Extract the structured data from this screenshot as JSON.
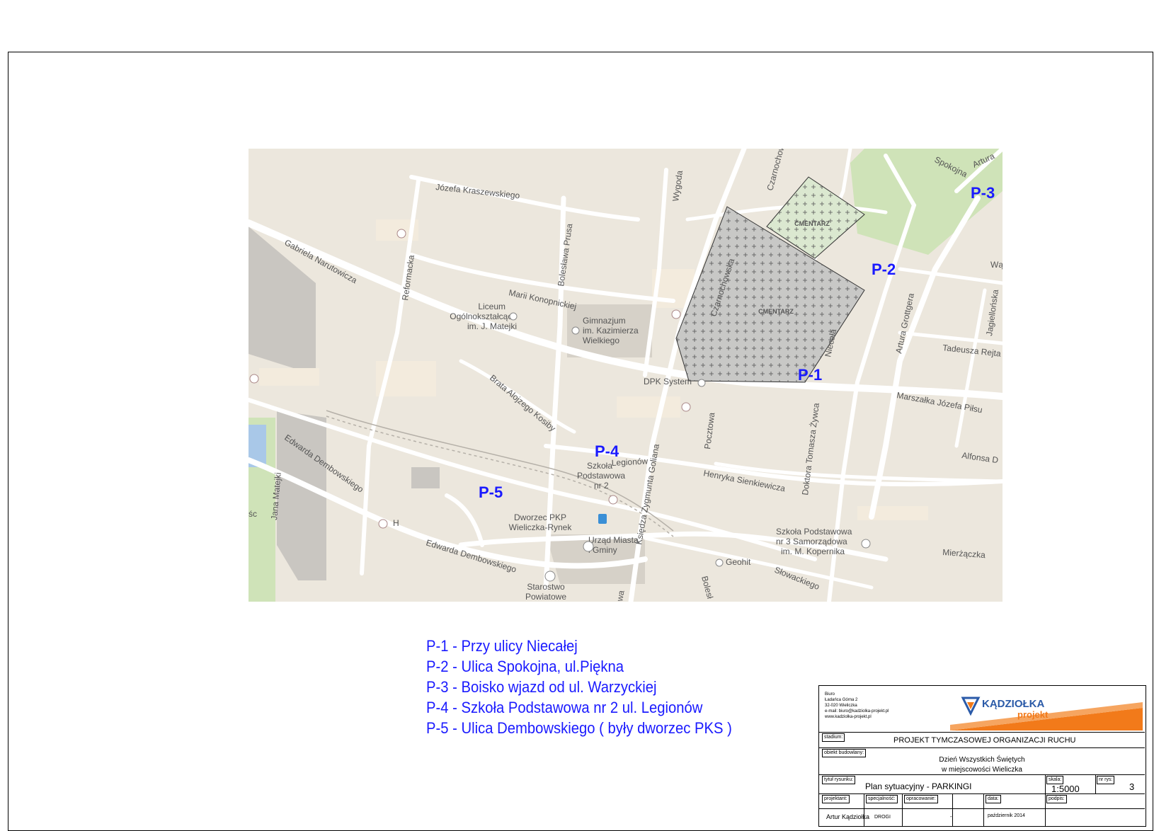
{
  "map": {
    "streets": [
      "Józefa Kraszewskiego",
      "Gabriela Narutowicza",
      "Reformacka",
      "Bolesława Prusa",
      "Wygoda",
      "Czarnochowska",
      "Marii Konopnickiej",
      "Brata Alojzego Kosiby",
      "Edwarda Dembowskiego",
      "Edwarda Dembowskiego",
      "Jana Matejki",
      "Legionów",
      "Księdza Zygmunta Goliana",
      "Pocztowa",
      "Henryka Sienkiewicza",
      "Doktora Tomasza Żywca",
      "Niecała",
      "Marszałka Józefa Piłsu",
      "Artura Grottgera",
      "Jagiellońska",
      "Tadeusza Rejta",
      "Alfonsa D",
      "Mierżączka",
      "Słowackiego",
      "Spokojna",
      "Artura",
      "Wą",
      "Bolesł",
      "śc",
      "wa"
    ],
    "places": {
      "liceum": [
        "Liceum",
        "Ogólnokształcące",
        "im. J. Matejki"
      ],
      "gimnazjum": [
        "Gimnazjum",
        "im. Kazimierza",
        "Wielkiego"
      ],
      "dpk": "DPK System",
      "szkola2": [
        "Szkoła",
        "Podstawowa",
        "nr 2"
      ],
      "dworzec": [
        "Dworzec PKP",
        "Wieliczka-Rynek"
      ],
      "urzad": [
        "Urząd Miasta",
        "i Gminy"
      ],
      "starostwo": [
        "Starostwo",
        "Powiatowe"
      ],
      "szkola3": [
        "Szkoła Podstawowa",
        "nr 3 Samorządowa",
        "im. M. Kopernika"
      ],
      "geohit": "Geohit",
      "h": "H"
    },
    "cemeteries": [
      "CMENTARZ",
      "CMENTARZ"
    ],
    "markers": {
      "p1": "P-1",
      "p2": "P-2",
      "p3": "P-3",
      "p4": "P-4",
      "p5": "P-5"
    }
  },
  "legend": [
    "P-1 - Przy ulicy Niecałej",
    "P-2 - Ulica Spokojna, ul.Piękna",
    "P-3 - Boisko wjazd od ul. Warzyckiej",
    "P-4 - Szkoła Podstawowa nr 2 ul. Legionów",
    "P-5 - Ulica Dembowskiego ( były dworzec PKS )"
  ],
  "title_block": {
    "office": [
      "Biuro",
      "Ładańca Górna 2",
      "32-020 Wieliczka",
      "e-mail: biuro@kadziolka-projekt.pl",
      "www.kadziolka-projekt.pl"
    ],
    "logo_main": "KĄDZIOŁKA",
    "logo_sub": "projekt",
    "stadium_label": "stadium:",
    "stadium_value": "PROJEKT TYMCZASOWEJ ORGANIZACJI RUCHU",
    "object_label": "obiekt budowlany:",
    "object_line1": "Dzień Wszystkich Świętych",
    "object_line2": "w miejscowości Wieliczka",
    "drawing_label": "tytuł rysunku:",
    "drawing_value": "Plan sytuacyjny - PARKINGI",
    "scale_label": "skala:",
    "scale_value": "1:5000",
    "number_label": "nr rys:",
    "number_value": "3",
    "designer_label": "projektant:",
    "designer_value": "Artur Kądziołka",
    "spec_label": "specjalność:",
    "spec_value": "DROGI",
    "drafted_label": "opracowanie:",
    "drafted_value": "-",
    "date_label": "data:",
    "date_value": "październik 2014",
    "sign_label": "podpis:"
  }
}
